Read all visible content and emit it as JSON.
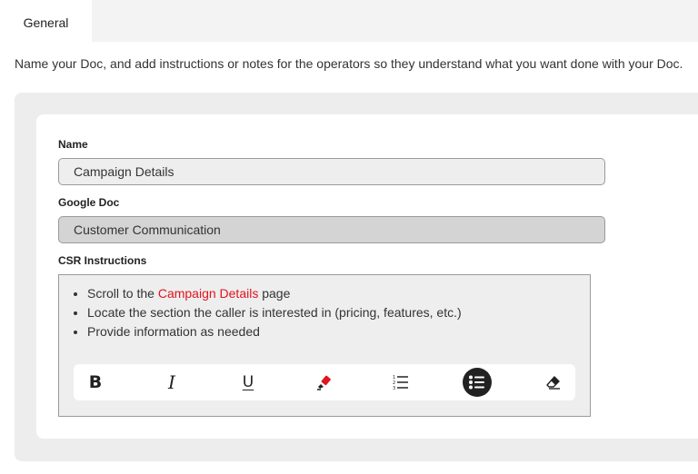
{
  "tabs": [
    {
      "label": "General"
    }
  ],
  "intro": "Name your Doc, and add instructions or notes for the operators so they understand what you want done with your Doc.",
  "form": {
    "name_label": "Name",
    "name_value": "Campaign Details",
    "gdoc_label": "Google Doc",
    "gdoc_value": "Customer Communication",
    "csr_label": "CSR Instructions",
    "instructions": {
      "item1_before": "Scroll to the ",
      "item1_link": "Campaign Details",
      "item1_after": " page",
      "item2": "Locate the section the caller is interested in (pricing, features, etc.)",
      "item3": "Provide information as needed"
    }
  },
  "toolbar": {
    "buttons": [
      "bold-icon",
      "italic-icon",
      "underline-icon",
      "highlighter-icon",
      "ordered-list-icon",
      "bulleted-list-icon",
      "eraser-icon"
    ],
    "active": "bulleted-list-icon",
    "highlight_color": "#e0141e"
  },
  "colors": {
    "link": "#e0141e",
    "active_button": "#222222"
  }
}
